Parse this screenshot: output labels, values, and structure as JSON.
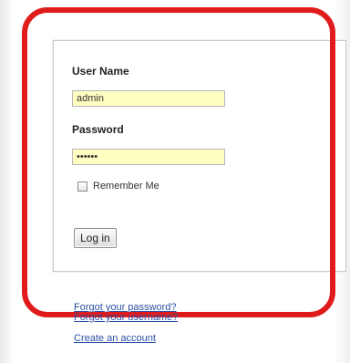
{
  "login_form": {
    "username_label": "User Name",
    "username_value": "admin",
    "password_label": "Password",
    "password_value": "••••••",
    "remember_label": "Remember Me",
    "remember_checked": false,
    "login_button": "Log in"
  },
  "links": {
    "forgot_password": "Forgot your password?",
    "forgot_username": "Forgot your username?",
    "create_account": "Create an account"
  },
  "colors": {
    "highlight": "#e01b1b",
    "input_bg": "#ffffc2",
    "link": "#2a4fa6"
  }
}
